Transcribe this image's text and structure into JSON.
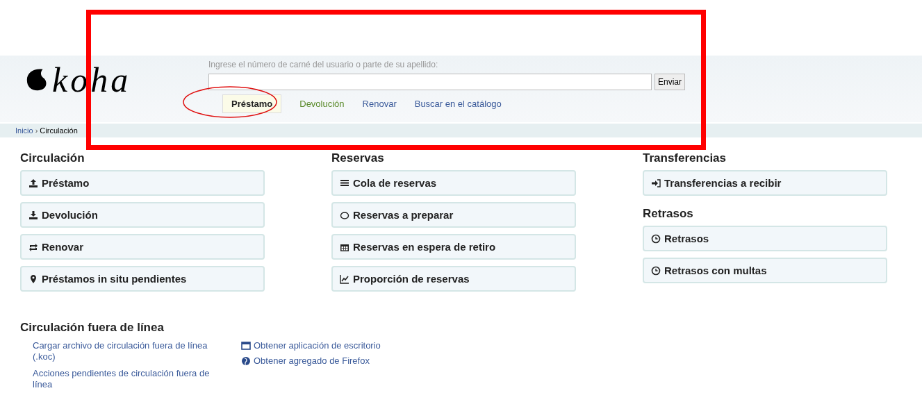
{
  "header": {
    "logo": "koha",
    "search_label": "Ingrese el número de carné del usuario o parte de su apellido:",
    "submit": "Enviar",
    "tabs": [
      {
        "label": "Préstamo",
        "selected": true,
        "color": "#222222"
      },
      {
        "label": "Devolución",
        "selected": false,
        "color": "#5a8a2a"
      },
      {
        "label": "Renovar",
        "selected": false,
        "color": "#3a5a9a"
      },
      {
        "label": "Buscar en el catálogo",
        "selected": false,
        "color": "#3a5a9a"
      }
    ]
  },
  "breadcrumb": {
    "items": [
      "Inicio",
      "Circulación"
    ],
    "separator": "›"
  },
  "columns": [
    {
      "sections": [
        {
          "title": "Circulación",
          "items": [
            "Préstamo",
            "Devolución",
            "Renovar",
            "Préstamos in situ pendientes"
          ]
        }
      ]
    },
    {
      "sections": [
        {
          "title": "Reservas",
          "items": [
            "Cola de reservas",
            "Reservas a preparar",
            "Reservas en espera de retiro",
            "Proporción de reservas"
          ]
        }
      ]
    },
    {
      "sections": [
        {
          "title": "Transferencias",
          "items": [
            "Transferencias a recibir"
          ]
        },
        {
          "title": "Retrasos",
          "items": [
            "Retrasos",
            "Retrasos con multas"
          ]
        }
      ]
    }
  ],
  "offline": {
    "title": "Circulación fuera de línea",
    "links": [
      "Cargar archivo de circulación fuera de línea (.koc)",
      "Acciones pendientes de circulación fuera de línea"
    ],
    "apps": [
      "Obtener aplicación de escritorio",
      "Obtener agregado de Firefox"
    ]
  }
}
